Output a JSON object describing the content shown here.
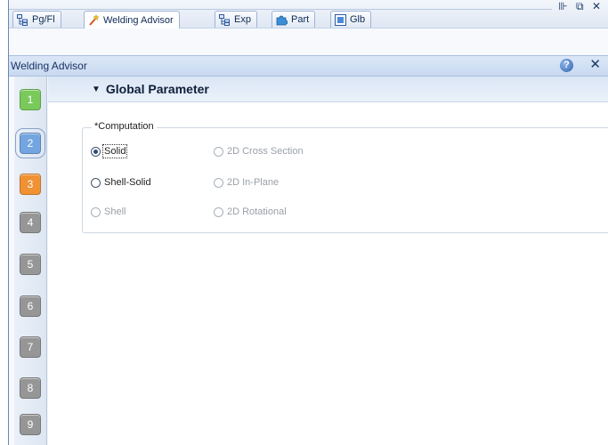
{
  "window": {
    "controls": "⊪ ⧉ ✕",
    "tabs": [
      {
        "label": "Pg/Fl",
        "icon": "tree-grid-icon",
        "active": false
      },
      {
        "label": "Welding Advisor",
        "icon": "welding-wand-icon",
        "active": true
      },
      {
        "label": "Exp",
        "icon": "tree-grid-icon",
        "active": false
      },
      {
        "label": "Part",
        "icon": "puzzle-piece-icon",
        "active": false
      },
      {
        "label": "Glb",
        "icon": "globe-box-icon",
        "active": false
      }
    ]
  },
  "panel": {
    "title": "Welding Advisor",
    "help_label": "?",
    "close_label": "✕"
  },
  "steps": [
    {
      "label": "1",
      "color": "#79c95b"
    },
    {
      "label": "2",
      "color": "#73a6e0"
    },
    {
      "label": "3",
      "color": "#f09133"
    },
    {
      "label": "4",
      "color": "#969696"
    },
    {
      "label": "5",
      "color": "#969696"
    },
    {
      "label": "6",
      "color": "#969696"
    },
    {
      "label": "7",
      "color": "#969696"
    },
    {
      "label": "8",
      "color": "#969696"
    },
    {
      "label": "9",
      "color": "#969696"
    }
  ],
  "section": {
    "chevron": "▼",
    "title": "Global Parameter"
  },
  "computation": {
    "legend": "*Computation",
    "options": [
      {
        "label": "Solid",
        "checked": true,
        "enabled": true
      },
      {
        "label": "Shell-Solid",
        "checked": false,
        "enabled": true
      },
      {
        "label": "Shell",
        "checked": false,
        "enabled": false
      },
      {
        "label": "2D Cross Section",
        "checked": false,
        "enabled": false
      },
      {
        "label": "2D In-Plane",
        "checked": false,
        "enabled": false
      },
      {
        "label": "2D Rotational",
        "checked": false,
        "enabled": false
      }
    ]
  }
}
